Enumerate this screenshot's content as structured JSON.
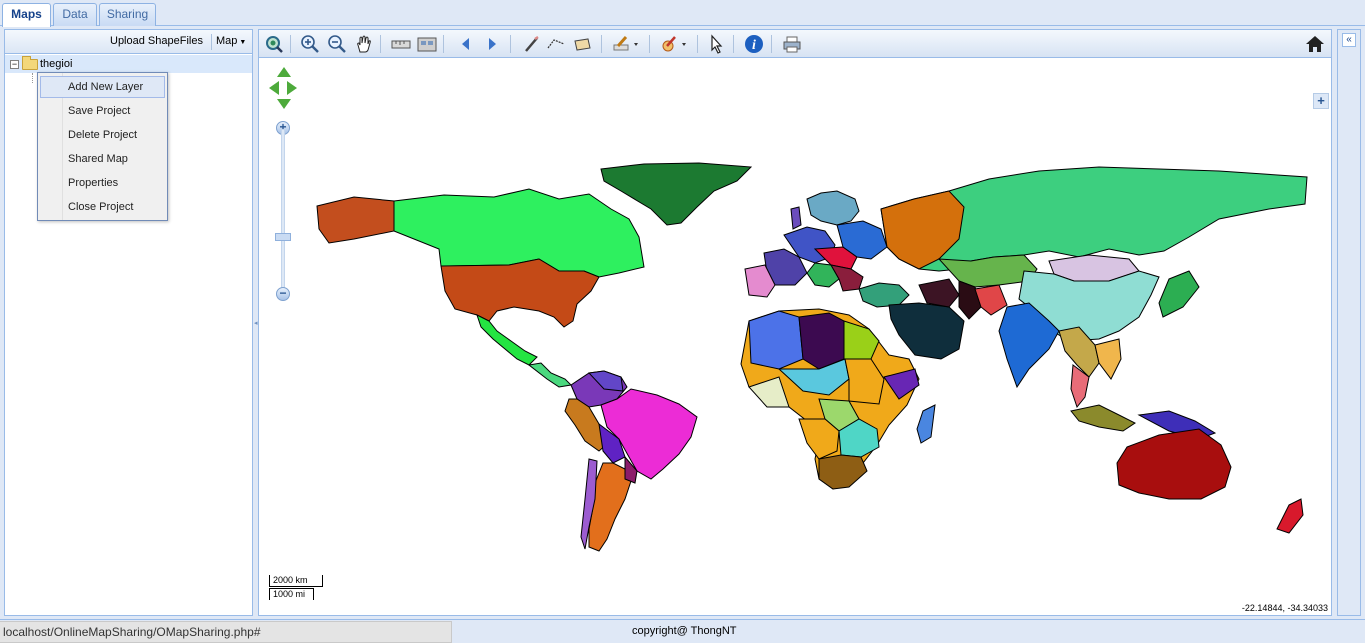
{
  "tabs": [
    {
      "label": "Maps",
      "active": true
    },
    {
      "label": "Data",
      "active": false
    },
    {
      "label": "Sharing",
      "active": false
    }
  ],
  "left_panel": {
    "toolbar": {
      "upload_label": "Upload ShapeFiles",
      "map_menu_label": "Map"
    },
    "tree": {
      "root_label": "thegioi",
      "expanded": true
    }
  },
  "context_menu": {
    "items": [
      {
        "label": "Add New Layer",
        "highlighted": true
      },
      {
        "label": "Save Project"
      },
      {
        "label": "Delete Project"
      },
      {
        "label": "Shared Map"
      },
      {
        "label": "Properties"
      },
      {
        "label": "Close Project"
      }
    ]
  },
  "map_toolbar": {
    "icons": [
      "zoom-extent-icon",
      "zoom-in-icon",
      "zoom-out-icon",
      "pan-hand-icon",
      "measure-length-icon",
      "measure-area-icon",
      "previous-view-icon",
      "next-view-icon",
      "draw-pencil-icon",
      "draw-line-icon",
      "draw-polygon-icon",
      "edit-icon",
      "feature-style-icon",
      "select-arrow-icon",
      "info-icon",
      "print-icon",
      "home-icon"
    ]
  },
  "map": {
    "scale_km": "2000 km",
    "scale_mi": "1000 mi",
    "coordinates": "-22.14844, -34.34033"
  },
  "footer": {
    "status_url": "localhost/OnlineMapSharing/OMapSharing.php#",
    "copyright": "copyright@ ThongNT"
  },
  "colors": {
    "chrome": "#dfe8f6",
    "border": "#99bbe8",
    "highlight": "#d9e8fb"
  }
}
